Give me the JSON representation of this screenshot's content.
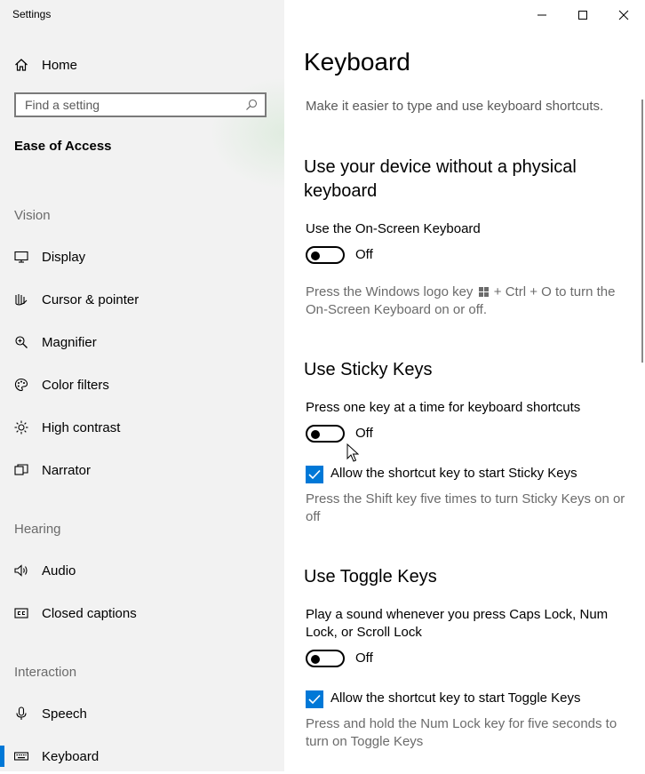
{
  "window": {
    "title": "Settings",
    "controls": {
      "minimize": "minimize",
      "maximize": "maximize",
      "close": "close"
    }
  },
  "sidebar": {
    "home_label": "Home",
    "search": {
      "placeholder": "Find a setting",
      "value": ""
    },
    "section_title": "Ease of Access",
    "groups": [
      {
        "label": "Vision",
        "items": [
          {
            "label": "Display",
            "icon": "monitor-icon"
          },
          {
            "label": "Cursor & pointer",
            "icon": "cursor-icon"
          },
          {
            "label": "Magnifier",
            "icon": "magnifier-icon"
          },
          {
            "label": "Color filters",
            "icon": "palette-icon"
          },
          {
            "label": "High contrast",
            "icon": "brightness-icon"
          },
          {
            "label": "Narrator",
            "icon": "narrator-icon"
          }
        ]
      },
      {
        "label": "Hearing",
        "items": [
          {
            "label": "Audio",
            "icon": "speaker-icon"
          },
          {
            "label": "Closed captions",
            "icon": "captions-icon"
          }
        ]
      },
      {
        "label": "Interaction",
        "items": [
          {
            "label": "Speech",
            "icon": "microphone-icon"
          },
          {
            "label": "Keyboard",
            "icon": "keyboard-icon",
            "selected": true
          }
        ]
      }
    ]
  },
  "main": {
    "title": "Keyboard",
    "subtitle": "Make it easier to type and use keyboard shortcuts.",
    "osk": {
      "heading": "Use your device without a physical keyboard",
      "toggle_label": "Use the On-Screen Keyboard",
      "toggle_state": "Off",
      "desc_before_icon": "Press the Windows logo key",
      "desc_after_icon": "+ Ctrl + O to turn the On-Screen Keyboard on or off."
    },
    "sticky": {
      "heading": "Use Sticky Keys",
      "toggle_label": "Press one key at a time for keyboard shortcuts",
      "toggle_state": "Off",
      "checkbox_label": "Allow the shortcut key to start Sticky Keys",
      "checkbox_checked": true,
      "desc": "Press the Shift key five times to turn Sticky Keys on or off"
    },
    "togglekeys": {
      "heading": "Use Toggle Keys",
      "toggle_label": "Play a sound whenever you press Caps Lock, Num Lock, or Scroll Lock",
      "toggle_state": "Off",
      "checkbox_label": "Allow the shortcut key to start Toggle Keys",
      "checkbox_checked": true,
      "desc": "Press and hold the Num Lock key for five seconds to turn on Toggle Keys"
    }
  },
  "colors": {
    "accent": "#0078d7",
    "sidebar_bg": "#f2f2f2",
    "secondary_text": "#6b6b6b"
  }
}
